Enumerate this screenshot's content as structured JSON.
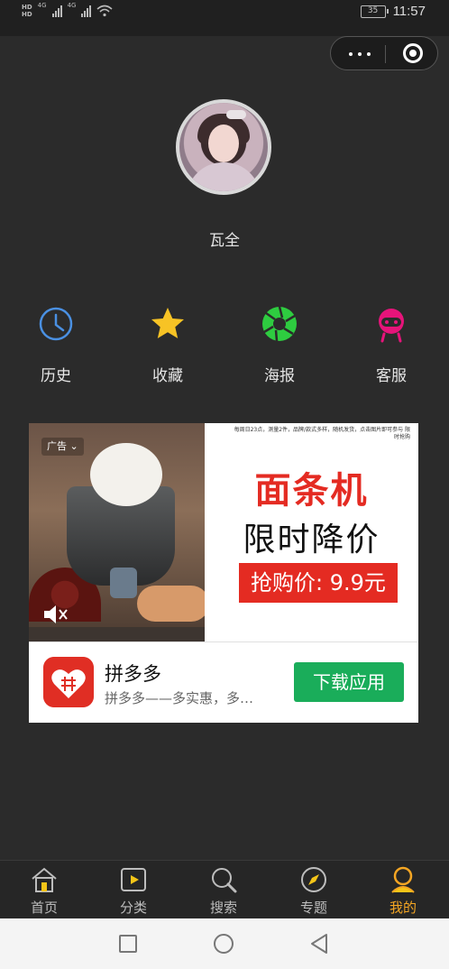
{
  "status_bar": {
    "hd1": "HD",
    "hd2": "HD",
    "net1": "4G",
    "net2": "4G",
    "battery": "35",
    "time": "11:57"
  },
  "capsule": {
    "more_icon": "more-dots-icon",
    "close_icon": "target-close-icon"
  },
  "profile": {
    "username": "瓦全"
  },
  "shortcuts": [
    {
      "label": "历史",
      "icon": "clock-icon",
      "color": "#4a90e2"
    },
    {
      "label": "收藏",
      "icon": "star-icon",
      "color": "#f7c325"
    },
    {
      "label": "海报",
      "icon": "aperture-icon",
      "color": "#2ecc40"
    },
    {
      "label": "客服",
      "icon": "service-face-icon",
      "color": "#e6147a"
    }
  ],
  "ad": {
    "tag": "广告",
    "small_text": "每周日23点，测量2件，品牌/款式多样，随机发货，点击图片即可参与 限时抢购",
    "headline": "面条机",
    "subheadline": "限时降价",
    "price": "抢购价: 9.9元",
    "app_name": "拼多多",
    "app_desc": "拼多多——多实惠，多…",
    "download_label": "下载应用",
    "brand_color": "#e42b22",
    "button_color": "#1aad5a"
  },
  "tabbar": {
    "items": [
      {
        "label": "首页",
        "icon": "home-icon",
        "active": false
      },
      {
        "label": "分类",
        "icon": "category-play-icon",
        "active": false
      },
      {
        "label": "搜索",
        "icon": "search-icon",
        "active": false
      },
      {
        "label": "专题",
        "icon": "compass-icon",
        "active": false
      },
      {
        "label": "我的",
        "icon": "user-icon",
        "active": true
      }
    ],
    "active_color": "#f5a623"
  }
}
